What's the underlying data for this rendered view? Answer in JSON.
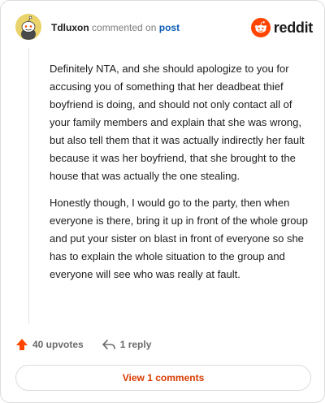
{
  "header": {
    "author": "Tdluxon",
    "verb": "commented on",
    "post_link": "post",
    "brand": "reddit"
  },
  "comment": {
    "paragraphs": [
      "Definitely NTA, and she should apologize to you for accusing you of something that her deadbeat thief boyfriend is doing, and should not only contact all of your family members and explain that she was wrong, but also tell them that it was actually indirectly her fault because it was her boyfriend, that she brought to the house that was actually the one stealing.",
      "Honestly though, I would go to the party, then when everyone is there, bring it up in front of the whole group and put your sister on blast in front of everyone so she has to explain the whole situation to the group and everyone will see who was really at fault."
    ]
  },
  "actions": {
    "upvotes": "40 upvotes",
    "replies": "1 reply"
  },
  "footer": {
    "view_button": "View 1 comments"
  },
  "colors": {
    "brand_orange": "#ff4500",
    "link_blue": "#0a5cb8",
    "button_text": "#d93a00"
  },
  "icons": {
    "avatar": "snoo-avatar",
    "logo": "reddit-logo-icon",
    "upvote": "upvote-arrow-icon",
    "reply": "reply-icon"
  }
}
